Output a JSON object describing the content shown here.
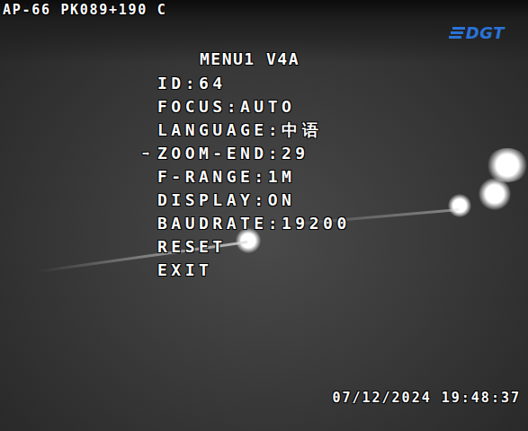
{
  "camera": {
    "label": "AP-66 PK089+190 C",
    "logo": "DGT",
    "timestamp": "07/12/2024 19:48:37"
  },
  "menu": {
    "title": "MENU1 V4A",
    "pointer": "➡",
    "items": [
      {
        "label": "ID:64",
        "selected": false
      },
      {
        "label": "FOCUS:AUTO",
        "selected": false
      },
      {
        "label": "LANGUAGE:中语",
        "selected": false
      },
      {
        "label": "ZOOM-END:29",
        "selected": true
      },
      {
        "label": "F-RANGE:1M",
        "selected": false
      },
      {
        "label": "DISPLAY:ON",
        "selected": false
      },
      {
        "label": "BAUDRATE:19200",
        "selected": false
      },
      {
        "label": "RESET",
        "selected": false
      },
      {
        "label": "EXIT",
        "selected": false
      }
    ]
  }
}
